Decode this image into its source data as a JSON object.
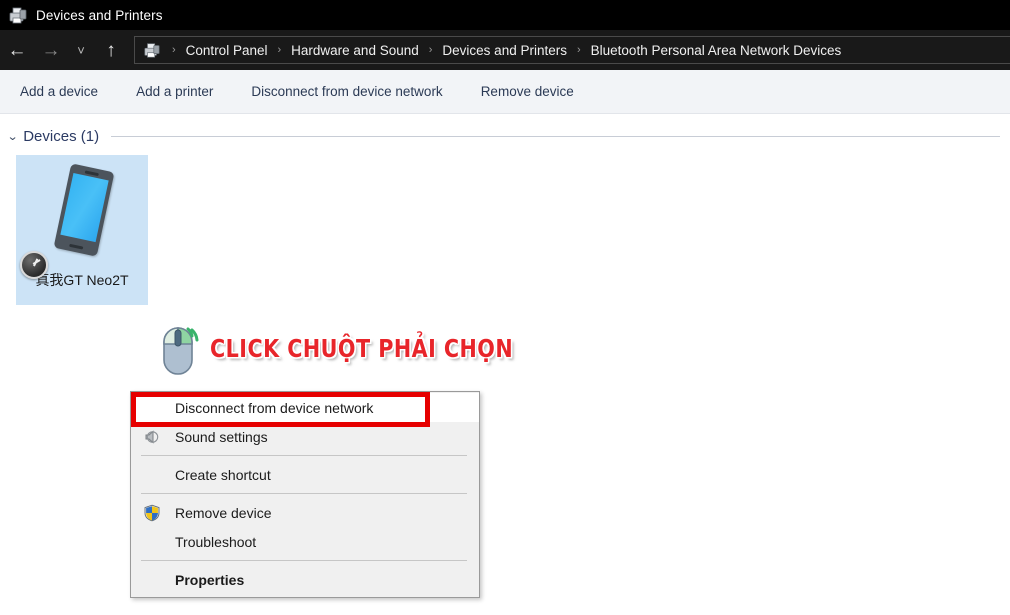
{
  "window": {
    "title": "Devices and Printers",
    "title_icon": "devices-and-printers-icon"
  },
  "navigation": {
    "back_icon": "back-arrow-icon",
    "forward_icon": "forward-arrow-icon",
    "recent_icon": "chevron-down-icon",
    "up_icon": "up-arrow-icon",
    "address_icon": "devices-and-printers-icon",
    "separator": "›",
    "breadcrumbs": [
      "Control Panel",
      "Hardware and Sound",
      "Devices and Printers",
      "Bluetooth Personal Area Network Devices"
    ]
  },
  "toolbar": {
    "commands": [
      "Add a device",
      "Add a printer",
      "Disconnect from device network",
      "Remove device"
    ]
  },
  "content": {
    "group": {
      "chevron_icon": "chevron-down-icon",
      "label": "Devices (1)"
    },
    "devices": [
      {
        "label": "真我GT Neo2T",
        "icon": "smartphone-icon",
        "badge_icon": "clock-badge-icon",
        "selected": true
      }
    ]
  },
  "annotation": {
    "mouse_icon": "right-click-mouse-icon",
    "text": "CLICK CHUỘT PHẢI CHỌN",
    "text_color": "#e8252a",
    "highlight_color": "#e60000"
  },
  "context_menu": {
    "items": [
      {
        "label": "Disconnect from device network",
        "icon": "",
        "selected": true,
        "bold": false,
        "separator_after": false
      },
      {
        "label": "Sound settings",
        "icon": "speaker-icon",
        "selected": false,
        "bold": false,
        "separator_after": true
      },
      {
        "label": "Create shortcut",
        "icon": "",
        "selected": false,
        "bold": false,
        "separator_after": true
      },
      {
        "label": "Remove device",
        "icon": "shield-icon",
        "selected": false,
        "bold": false,
        "separator_after": false
      },
      {
        "label": "Troubleshoot",
        "icon": "",
        "selected": false,
        "bold": false,
        "separator_after": true
      },
      {
        "label": "Properties",
        "icon": "",
        "selected": false,
        "bold": true,
        "separator_after": false
      }
    ]
  }
}
